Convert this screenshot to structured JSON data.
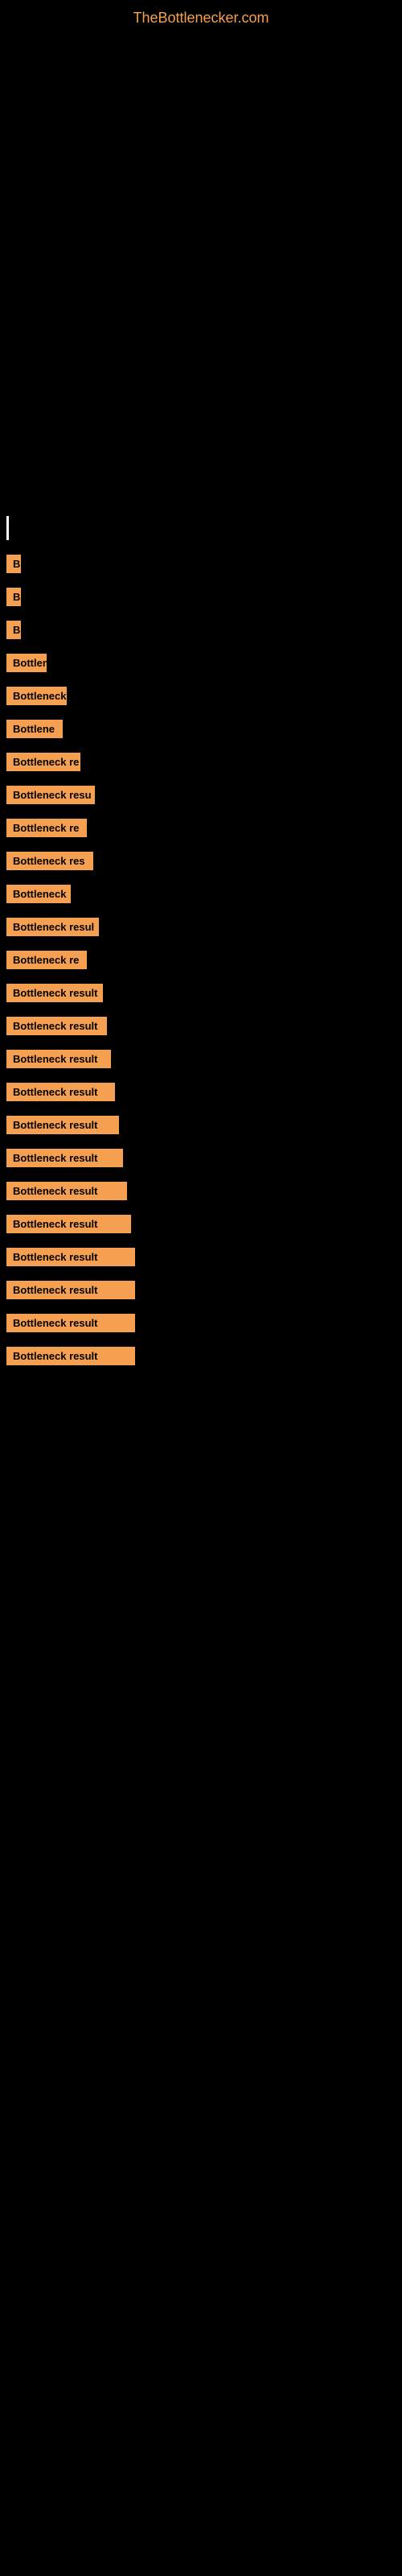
{
  "site": {
    "title": "TheBottlenecker.com"
  },
  "items": [
    {
      "id": 1,
      "label": "B",
      "width_class": "w-10"
    },
    {
      "id": 2,
      "label": "B",
      "width_class": "w-12"
    },
    {
      "id": 3,
      "label": "B",
      "width_class": "w-14"
    },
    {
      "id": 4,
      "label": "Bottlen",
      "width_class": "w-30"
    },
    {
      "id": 5,
      "label": "Bottleneck",
      "width_class": "w-60"
    },
    {
      "id": 6,
      "label": "Bottlene",
      "width_class": "w-65"
    },
    {
      "id": 7,
      "label": "Bottleneck re",
      "width_class": "w-80"
    },
    {
      "id": 8,
      "label": "Bottleneck resu",
      "width_class": "w-100"
    },
    {
      "id": 9,
      "label": "Bottleneck re",
      "width_class": "w-105"
    },
    {
      "id": 10,
      "label": "Bottleneck res",
      "width_class": "w-110"
    },
    {
      "id": 11,
      "label": "Bottleneck",
      "width_class": "w-80b"
    },
    {
      "id": 12,
      "label": "Bottleneck resul",
      "width_class": "w-115"
    },
    {
      "id": 13,
      "label": "Bottleneck re",
      "width_class": "w-112"
    },
    {
      "id": 14,
      "label": "Bottleneck result",
      "width_class": "w-120"
    },
    {
      "id": 15,
      "label": "Bottleneck result",
      "width_class": "w-125"
    },
    {
      "id": 16,
      "label": "Bottleneck result",
      "width_class": "w-130"
    },
    {
      "id": 17,
      "label": "Bottleneck result",
      "width_class": "w-135"
    },
    {
      "id": 18,
      "label": "Bottleneck result",
      "width_class": "w-140"
    },
    {
      "id": 19,
      "label": "Bottleneck result",
      "width_class": "w-145"
    },
    {
      "id": 20,
      "label": "Bottleneck result",
      "width_class": "w-150"
    },
    {
      "id": 21,
      "label": "Bottleneck result",
      "width_class": "w-155"
    },
    {
      "id": 22,
      "label": "Bottleneck result",
      "width_class": "w-160"
    },
    {
      "id": 23,
      "label": "Bottleneck result",
      "width_class": "w-160"
    },
    {
      "id": 24,
      "label": "Bottleneck result",
      "width_class": "w-160"
    },
    {
      "id": 25,
      "label": "Bottleneck result",
      "width_class": "w-160"
    }
  ]
}
